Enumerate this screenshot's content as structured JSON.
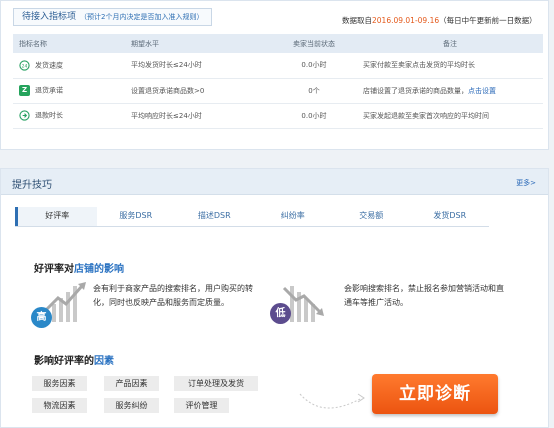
{
  "pending": {
    "title": "待接入指标项",
    "note": "（预计2个月内决定是否加入准入规则）"
  },
  "date_info": {
    "prefix": "数据取自",
    "range": "2016.09.01-09.16",
    "suffix": "（每日中午更新前一日数据）"
  },
  "table": {
    "headers": [
      "指标名称",
      "期望水平",
      "卖家当前状态",
      "备注"
    ],
    "rows": [
      {
        "icon": "clock-24-icon",
        "name": "发货速度",
        "expect": "平均发货时长≤24小时",
        "status": "0.0小时",
        "note": "买家付款至卖家点击发货的平均时长",
        "link": ""
      },
      {
        "icon": "return-z-icon",
        "name": "退货承诺",
        "expect": "设置退货承诺商品数>0",
        "status": "0个",
        "note": "店铺设置了退货承诺的商品数量，",
        "link": "点击设置"
      },
      {
        "icon": "reply-arrow-icon",
        "name": "退款时长",
        "expect": "平均响应时长≤24小时",
        "status": "0.0小时",
        "note": "买家发起退款至卖家首次响应的平均时间",
        "link": ""
      }
    ]
  },
  "tips": {
    "title": "提升技巧",
    "more": "更多>",
    "tabs": [
      "好评率",
      "服务DSR",
      "描述DSR",
      "纠纷率",
      "交易额",
      "发货DSR"
    ],
    "active_tab": 0
  },
  "impact": {
    "heading_a": "好评率对",
    "heading_b": "店铺的影响",
    "high_label": "高",
    "high_desc": "会有利于商家产品的搜索排名，用户购买的转化，同时也反映产品和服务而定质量。",
    "low_label": "低",
    "low_desc": "会影响搜索排名，禁止报名参加营销活动和直通车等推广活动。"
  },
  "factors": {
    "heading_a": "影响好评率的",
    "heading_b": "因素",
    "chips": [
      "服务因素",
      "产品因素",
      "订单处理及发货",
      "物流因素",
      "服务纠纷",
      "评价管理"
    ]
  },
  "diagnose_button": "立即诊断",
  "colors": {
    "accent_blue": "#2e6fb3",
    "date_orange": "#e45a1c",
    "button_orange": "#ec5410",
    "badge_high": "#2a88c8",
    "badge_low": "#5c4c8e"
  }
}
